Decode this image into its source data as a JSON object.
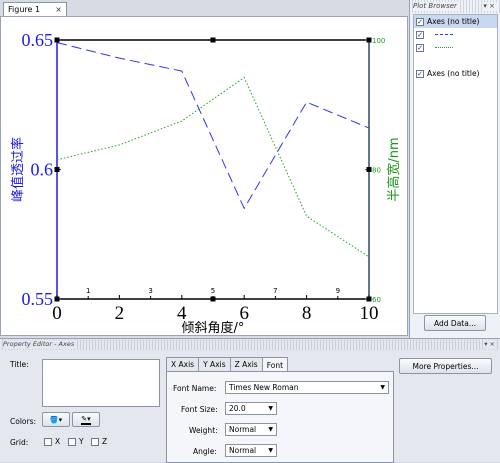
{
  "figure_tab": {
    "label": "Figure 1",
    "close": "×"
  },
  "plot_browser": {
    "title": "Plot Browser",
    "menu": "▾ ×",
    "items": [
      {
        "label": "Axes (no title)",
        "checked": true,
        "kind": "axes"
      },
      {
        "label": "",
        "checked": true,
        "kind": "dash"
      },
      {
        "label": "",
        "checked": true,
        "kind": "dot"
      },
      {
        "label": "Axes (no title)",
        "checked": true,
        "kind": "axes"
      }
    ],
    "add_data": "Add Data..."
  },
  "chart_data": {
    "type": "line",
    "xlabel": "倾斜角度/°",
    "ylabel_left": "峰值透过率",
    "ylabel_right": "半高宽/nm",
    "x_ticks_major": [
      "0",
      "2",
      "4",
      "6",
      "8",
      "10"
    ],
    "x_ticks_minor": [
      "1",
      "3",
      "5",
      "7",
      "9"
    ],
    "y_left_ticks": [
      "0.55",
      "0.6",
      "0.65"
    ],
    "y_right_ticks": [
      "60",
      "80",
      "100"
    ],
    "xlim": [
      0,
      10
    ],
    "ylim_left": [
      0.55,
      0.65
    ],
    "ylim_right": [
      60,
      100
    ],
    "series": [
      {
        "axis": "left",
        "style": "dashed",
        "color": "#3333ee",
        "x": [
          0,
          2,
          4,
          6,
          8,
          10
        ],
        "y": [
          0.649,
          0.643,
          0.638,
          0.585,
          0.626,
          0.616
        ]
      },
      {
        "axis": "right",
        "style": "dotted",
        "color": "#22aa22",
        "x": [
          0,
          2,
          4,
          6,
          8,
          10
        ],
        "y": [
          81.5,
          83.8,
          87.5,
          94.2,
          72.8,
          66.5
        ]
      }
    ],
    "left_color": "#1a1aee",
    "right_color": "#1a9a1a"
  },
  "property_editor": {
    "title": "Property Editor - Axes",
    "menu": "▾ ×",
    "title_label": "Title:",
    "colors_label": "Colors:",
    "grid_label": "Grid:",
    "grid_x": "X",
    "grid_y": "Y",
    "grid_z": "Z",
    "tabs": [
      "X Axis",
      "Y Axis",
      "Z Axis",
      "Font"
    ],
    "font_name_label": "Font Name:",
    "font_name_value": "Times New Roman",
    "font_size_label": "Font Size:",
    "font_size_value": "20.0",
    "weight_label": "Weight:",
    "weight_value": "Normal",
    "angle_label": "Angle:",
    "angle_value": "Normal",
    "more_properties": "More Properties..."
  }
}
